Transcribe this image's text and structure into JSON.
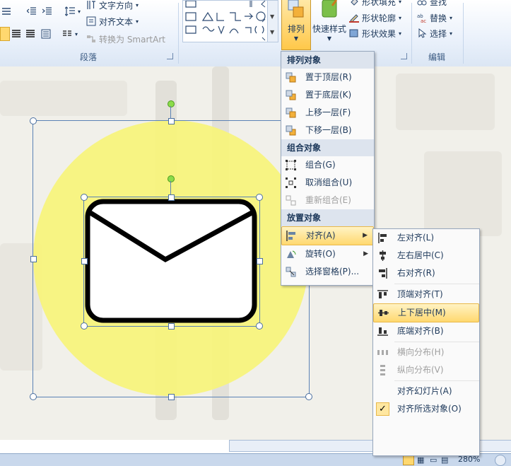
{
  "ribbon": {
    "paragraph": {
      "text_direction": "文字方向",
      "align_text": "对齐文本",
      "convert_smartart": "转换为 SmartArt",
      "group_label": "段落"
    },
    "drawing": {
      "arrange_label": "排列",
      "quick_styles_label": "快速样式",
      "shape_fill": "形状填充",
      "shape_outline": "形状轮廓",
      "shape_effects": "形状效果"
    },
    "editing": {
      "find": "查找",
      "replace": "替换",
      "select": "选择",
      "group_label": "编辑"
    }
  },
  "arrange_menu": {
    "header_order": "排列对象",
    "bring_front": "置于顶层(R)",
    "send_back": "置于底层(K)",
    "bring_forward": "上移一层(F)",
    "send_backward": "下移一层(B)",
    "header_group": "组合对象",
    "group": "组合(G)",
    "ungroup": "取消组合(U)",
    "regroup": "重新组合(E)",
    "header_position": "放置对象",
    "align": "对齐(A)",
    "rotate": "旋转(O)",
    "selection_pane": "选择窗格(P)..."
  },
  "align_menu": {
    "align_left": "左对齐(L)",
    "align_center": "左右居中(C)",
    "align_right": "右对齐(R)",
    "align_top": "顶端对齐(T)",
    "align_middle": "上下居中(M)",
    "align_bottom": "底端对齐(B)",
    "distribute_h": "横向分布(H)",
    "distribute_v": "纵向分布(V)",
    "align_to_slide": "对齐幻灯片(A)",
    "align_selected": "对齐所选对象(O)"
  },
  "status": {
    "zoom": "280%"
  },
  "colors": {
    "circle": "#f7f47a",
    "menu_highlight": "#ffd86f",
    "selection": "#5b82b5"
  }
}
